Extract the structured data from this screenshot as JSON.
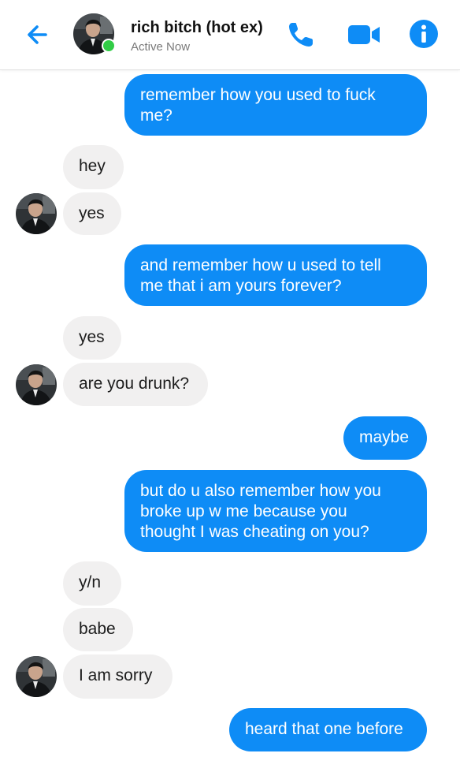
{
  "header": {
    "contact_name": "rich bitch (hot ex)",
    "status": "Active Now",
    "icons": [
      "back-arrow-icon",
      "phone-icon",
      "video-camera-icon",
      "info-icon"
    ],
    "accent_color": "#0e8cf6",
    "online_color": "#31cc46"
  },
  "messages": [
    {
      "from": "me",
      "text": "remember how you used to fuck\nme?"
    },
    {
      "from": "them",
      "text": "hey"
    },
    {
      "from": "them",
      "text": "yes"
    },
    {
      "from": "me",
      "text": "and remember how u used to tell\nme that i am yours forever?"
    },
    {
      "from": "them",
      "text": "yes"
    },
    {
      "from": "them",
      "text": "are you drunk?"
    },
    {
      "from": "me",
      "text": "maybe"
    },
    {
      "from": "me",
      "text": "but do u also remember how you\nbroke up w me because you\nthought I was cheating on you?"
    },
    {
      "from": "them",
      "text": "y/n"
    },
    {
      "from": "them",
      "text": "babe"
    },
    {
      "from": "them",
      "text": "I am sorry"
    },
    {
      "from": "me",
      "text": "heard that one before"
    }
  ]
}
